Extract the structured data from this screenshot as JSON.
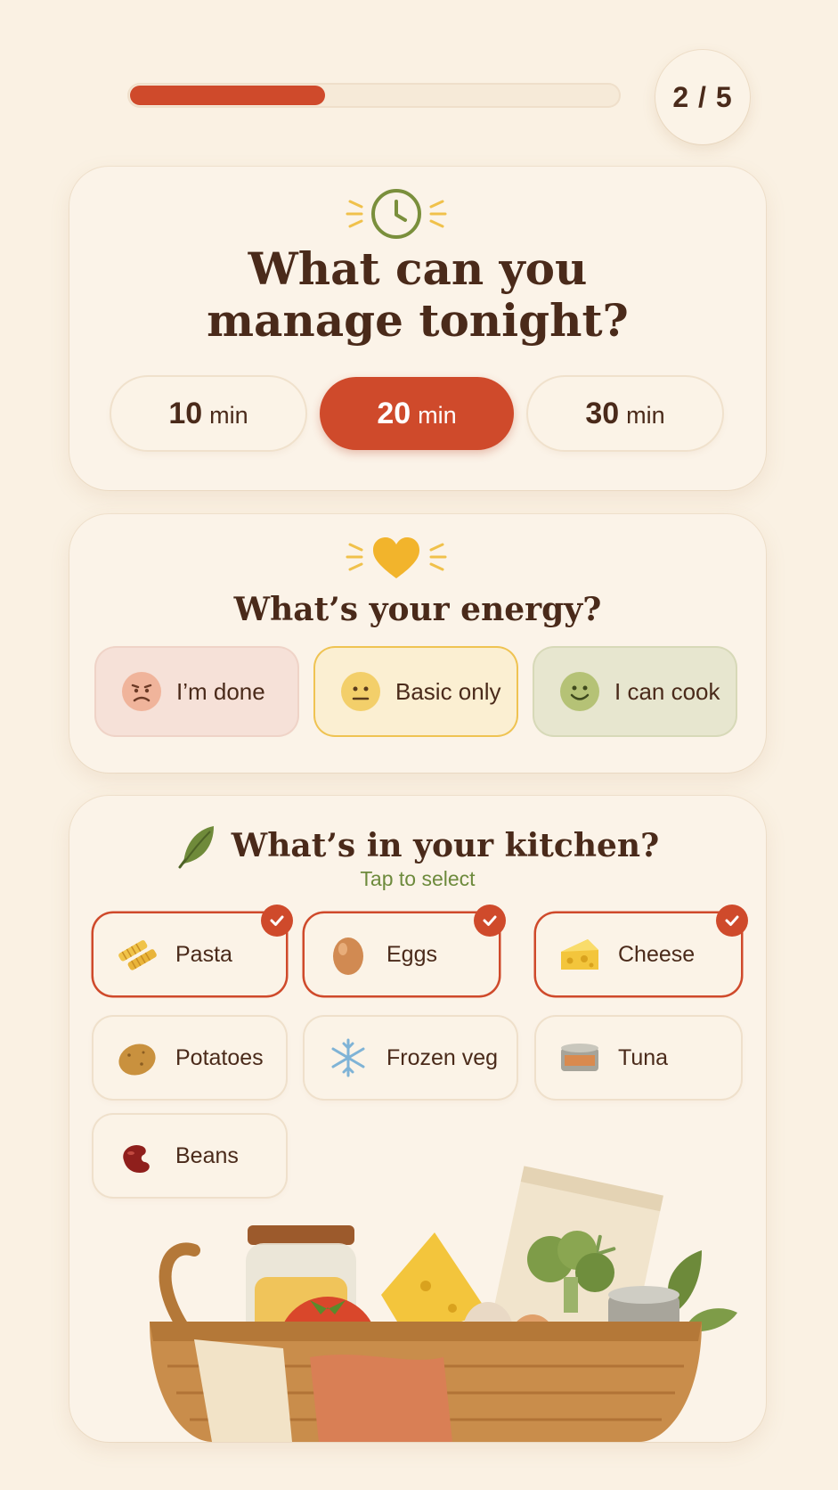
{
  "progress": {
    "fraction": 0.4,
    "step_label": "2 / 5",
    "accent_color": "#cf4a2b"
  },
  "time_card": {
    "icon": "clock-icon",
    "title_line1": "What can you",
    "title_line2": "manage tonight?",
    "options": [
      {
        "value": "10",
        "unit": "min",
        "selected": false
      },
      {
        "value": "20",
        "unit": "min",
        "selected": true
      },
      {
        "value": "30",
        "unit": "min",
        "selected": false
      }
    ]
  },
  "energy_card": {
    "icon": "heart-icon",
    "title": "What’s your energy?",
    "options": [
      {
        "label": "I’m done",
        "icon": "sad-face-icon"
      },
      {
        "label": "Basic only",
        "icon": "neutral-face-icon",
        "selected": true
      },
      {
        "label": "I can cook",
        "icon": "happy-face-icon"
      }
    ]
  },
  "kitchen_card": {
    "icon": "leaf-icon",
    "title": "What’s in your kitchen?",
    "subtitle": "Tap to select",
    "items": [
      {
        "label": "Pasta",
        "icon": "pasta-icon",
        "selected": true
      },
      {
        "label": "Eggs",
        "icon": "egg-icon",
        "selected": true
      },
      {
        "label": "Cheese",
        "icon": "cheese-icon",
        "selected": true
      },
      {
        "label": "Potatoes",
        "icon": "potato-icon",
        "selected": false
      },
      {
        "label": "Frozen veg",
        "icon": "snowflake-icon",
        "selected": false
      },
      {
        "label": "Tuna",
        "icon": "tuna-can-icon",
        "selected": false
      },
      {
        "label": "Beans",
        "icon": "bean-icon",
        "selected": false
      }
    ]
  }
}
